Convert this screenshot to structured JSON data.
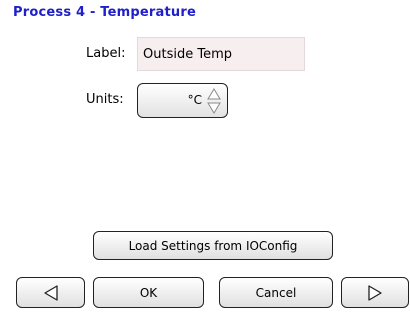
{
  "header": {
    "title": "Process 4 - Temperature"
  },
  "form": {
    "label_caption": "Label:",
    "label_value": "Outside Temp",
    "units_caption": "Units:",
    "units_value": "°C"
  },
  "actions": {
    "load_settings_label": "Load Settings from IOConfig"
  },
  "navigation": {
    "prev_icon": "triangle-left-icon",
    "ok_label": "OK",
    "cancel_label": "Cancel",
    "next_icon": "triangle-right-icon"
  },
  "colors": {
    "title": "#2020c8",
    "input_bg": "#f7eef0"
  }
}
